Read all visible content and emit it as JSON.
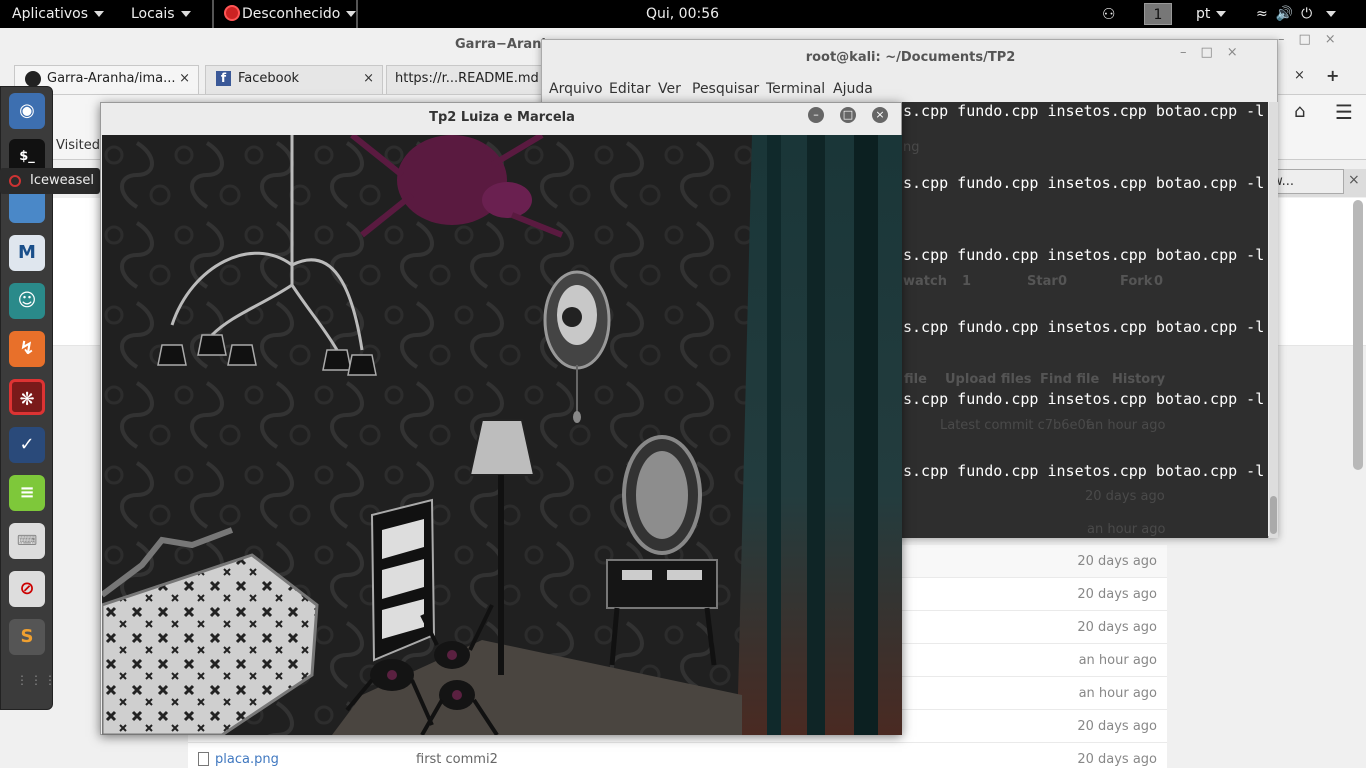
{
  "topbar": {
    "applications": "Aplicativos",
    "places": "Locais",
    "active_app": "Desconhecido",
    "clock": "Qui, 00:56",
    "workspace": "1",
    "language": "pt"
  },
  "browser": {
    "window_title": "Garra−Aranha",
    "tabs": [
      {
        "label": "Garra-Aranha/ima...",
        "close": "×"
      },
      {
        "label": "Facebook",
        "close": "×"
      },
      {
        "label": "https://r...README.md",
        "close": ""
      }
    ],
    "bookmarks": {
      "most_visited": "st Visited"
    },
    "follow_button": "llow...",
    "files": [
      {
        "name": "",
        "message": "",
        "age": "20 days ago"
      },
      {
        "name": "",
        "message": "",
        "age": "20 days ago"
      },
      {
        "name": "",
        "message": "",
        "age": "20 days ago"
      },
      {
        "name": "",
        "message": "",
        "age": "an hour ago"
      },
      {
        "name": "",
        "message": "",
        "age": "an hour ago"
      },
      {
        "name": "",
        "message": "",
        "age": "20 days ago"
      },
      {
        "name": "placa.png",
        "message": "first commi2",
        "age": "20 days ago"
      }
    ]
  },
  "dock": {
    "tooltip": "Iceweasel",
    "icons": [
      "browser-icon",
      "terminal-icon",
      "files-icon",
      "metasploit-icon",
      "armitage-icon",
      "burpsuite-icon",
      "faraday-icon",
      "cutycapt-icon",
      "notes-icon",
      "keyboard-icon",
      "recordmydesktop-icon",
      "sublime-icon"
    ]
  },
  "terminal": {
    "title": "root@kali: ~/Documents/TP2",
    "menu": [
      "Arquivo",
      "Editar",
      "Ver",
      "Pesquisar",
      "Terminal",
      "Ajuda"
    ],
    "lines": [
      "s.cpp fundo.cpp insetos.cpp botao.cpp -l",
      "s.cpp fundo.cpp insetos.cpp botao.cpp -l",
      "s.cpp fundo.cpp insetos.cpp botao.cpp -l",
      "s.cpp fundo.cpp insetos.cpp botao.cpp -l",
      "s.cpp fundo.cpp insetos.cpp botao.cpp -l",
      "s.cpp fundo.cpp insetos.cpp botao.cpp -l"
    ],
    "bleed": {
      "ng": "ng",
      "watch": "watch",
      "watch_count": "1",
      "star": "Star",
      "star_count": "0",
      "fork": "Fork",
      "fork_count": "0",
      "file": "file",
      "upload": "Upload files",
      "find": "Find file",
      "history": "History",
      "latest_commit": "Latest commit c7b6e0f",
      "latest_age": "an hour ago",
      "age1": "20 days ago",
      "age2": "an hour ago"
    }
  },
  "glwindow": {
    "title": "Tp2 Luiza e Marcela"
  }
}
